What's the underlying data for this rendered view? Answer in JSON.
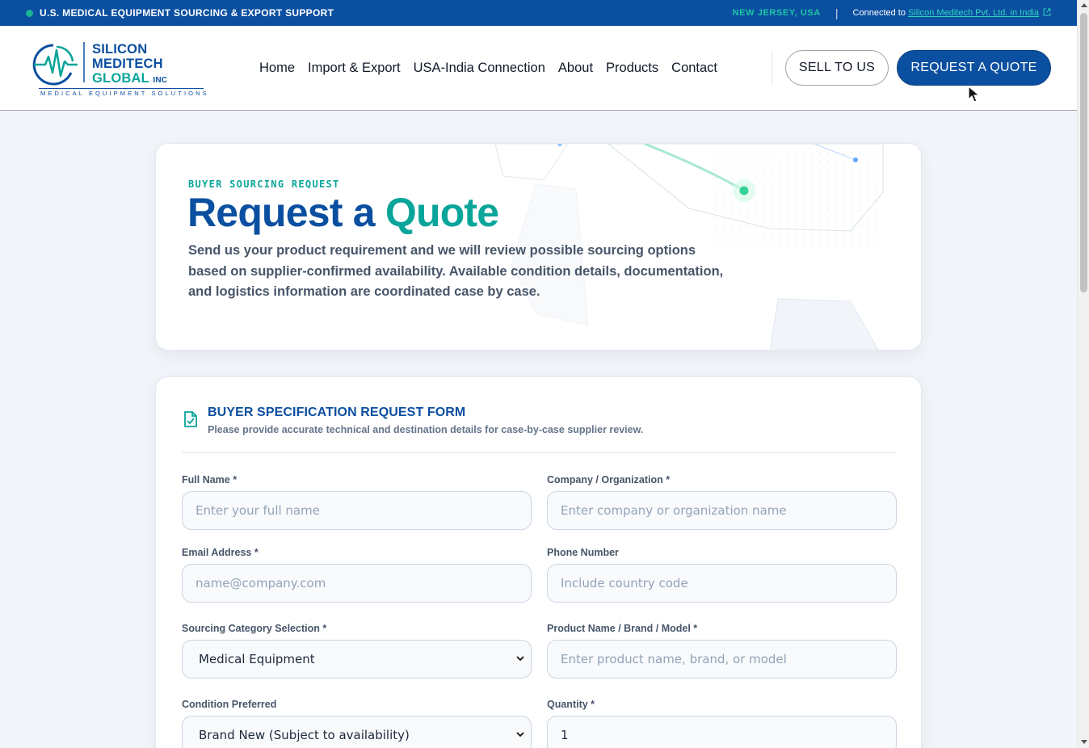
{
  "topbar": {
    "left_text": "U.S. MEDICAL EQUIPMENT SOURCING & EXPORT SUPPORT",
    "location": "NEW JERSEY, USA",
    "separator": "|",
    "connected_prefix": "Connected to",
    "connected_link": "Silicon Meditech Pvt. Ltd. in India"
  },
  "logo": {
    "line1": "SILICON",
    "line2": "MEDITECH",
    "line3": "GLOBAL",
    "suffix": "INC",
    "tagline": "MEDICAL EQUIPMENT SOLUTIONS"
  },
  "nav": {
    "items": [
      "Home",
      "Import & Export",
      "USA-India Connection",
      "About",
      "Products",
      "Contact"
    ],
    "sell_button": "SELL TO US",
    "quote_button": "REQUEST A QUOTE"
  },
  "hero": {
    "eyebrow": "BUYER SOURCING REQUEST",
    "title_main": "Request a ",
    "title_accent": "Quote",
    "description": "Send us your product requirement and we will review possible sourcing options based on supplier-confirmed availability. Available condition details, documentation, and logistics information are coordinated case by case."
  },
  "form": {
    "title": "BUYER SPECIFICATION REQUEST FORM",
    "subtitle": "Please provide accurate technical and destination details for case-by-case supplier review.",
    "fields": {
      "full_name": {
        "label": "Full Name *",
        "placeholder": "Enter your full name"
      },
      "company": {
        "label": "Company / Organization *",
        "placeholder": "Enter company or organization name"
      },
      "email": {
        "label": "Email Address *",
        "placeholder": "name@company.com"
      },
      "phone": {
        "label": "Phone Number",
        "placeholder": "Include country code"
      },
      "category": {
        "label": "Sourcing Category Selection *",
        "value": "Medical Equipment"
      },
      "product": {
        "label": "Product Name / Brand / Model *",
        "placeholder": "Enter product name, brand, or model"
      },
      "condition": {
        "label": "Condition Preferred",
        "value": "Brand New (Subject to availability)"
      },
      "quantity": {
        "label": "Quantity *",
        "value": "1"
      }
    }
  },
  "colors": {
    "primary": "#0b4fa0",
    "accent": "#0aa59a",
    "page_bg": "#f1f5f9"
  },
  "icons": [
    "external-link-icon",
    "logo-heartbeat-icon",
    "document-check-icon",
    "chevron-down-icon",
    "mouse-cursor-icon"
  ]
}
